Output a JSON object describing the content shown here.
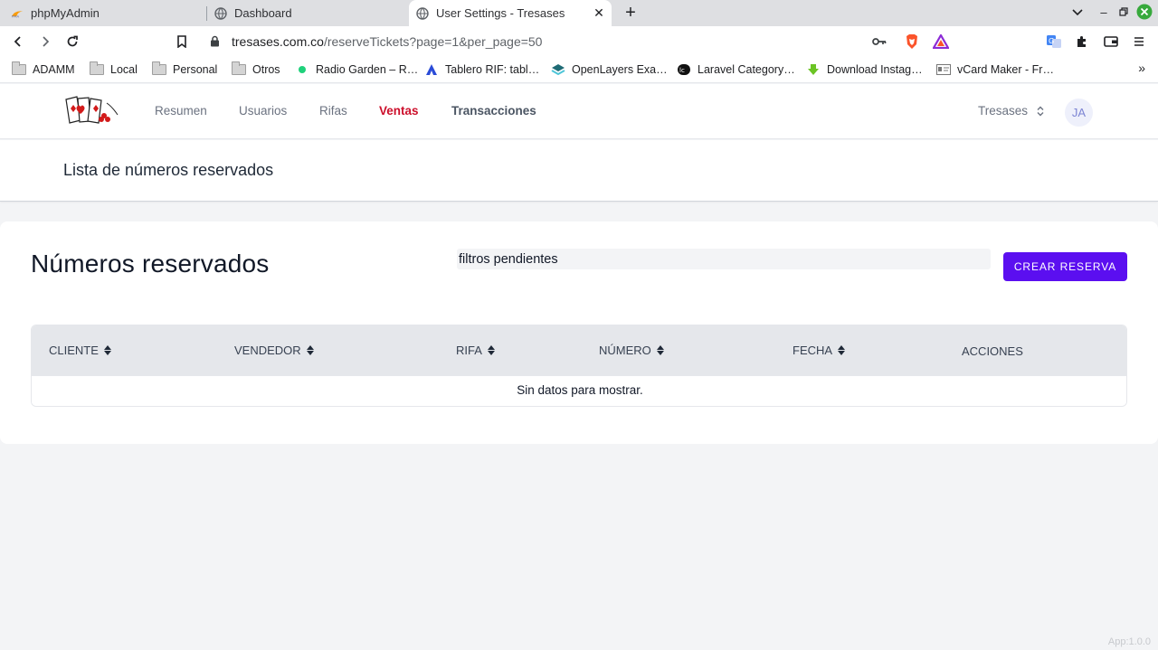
{
  "browser": {
    "tabs": [
      {
        "title": "phpMyAdmin",
        "icon": "phpmyadmin-icon",
        "active": false
      },
      {
        "title": "Dashboard",
        "icon": "globe-icon",
        "active": false
      },
      {
        "title": "User Settings - Tresases",
        "icon": "globe-icon",
        "active": true
      }
    ],
    "close_glyph": "✕",
    "newtab_glyph": "+",
    "window_controls": {
      "menu": "⌄",
      "minimize": "–",
      "restore": "❐",
      "close": "✕"
    },
    "url_host": "tresases.com.co",
    "url_path": "/reserveTickets?page=1&per_page=50",
    "bookmarks": [
      {
        "label": "ADAMM",
        "icon": "folder-icon"
      },
      {
        "label": "Local",
        "icon": "folder-icon"
      },
      {
        "label": "Personal",
        "icon": "folder-icon"
      },
      {
        "label": "Otros",
        "icon": "folder-icon"
      },
      {
        "label": "Radio Garden – R…",
        "icon": "radio-garden-icon"
      },
      {
        "label": "Tablero RIF: tabl…",
        "icon": "atlassian-icon"
      },
      {
        "label": "OpenLayers Exa…",
        "icon": "openlayers-icon"
      },
      {
        "label": "Laravel Category…",
        "icon": "laravel-icon"
      },
      {
        "label": "Download Instag…",
        "icon": "download-icon"
      },
      {
        "label": "vCard Maker - Fr…",
        "icon": "vcard-icon"
      }
    ],
    "bookmarks_more": "»"
  },
  "app": {
    "nav": {
      "items": [
        {
          "label": "Resumen"
        },
        {
          "label": "Usuarios"
        },
        {
          "label": "Rifas"
        },
        {
          "label": "Ventas"
        },
        {
          "label": "Transacciones"
        }
      ],
      "active": "Ventas",
      "team": "Tresases",
      "avatar_initials": "JA"
    },
    "header_title": "Lista de números reservados",
    "page_title": "Números reservados",
    "filter": {
      "value": "filtros pendientes",
      "placeholder": ""
    },
    "create_button": "CREAR RESERVA",
    "table": {
      "columns": [
        "CLIENTE",
        "VENDEDOR",
        "RIFA",
        "NÚMERO",
        "FECHA",
        "ACCIONES"
      ],
      "sortable": [
        true,
        true,
        true,
        true,
        true,
        false
      ],
      "rows": [],
      "empty_message": "Sin datos para mostrar."
    },
    "version": "App:1.0.0"
  },
  "colors": {
    "accent": "#5b0ff0",
    "nav_active": "#cc0f2b",
    "table_header": "#e5e7eb",
    "page_bg": "#f3f4f6"
  }
}
